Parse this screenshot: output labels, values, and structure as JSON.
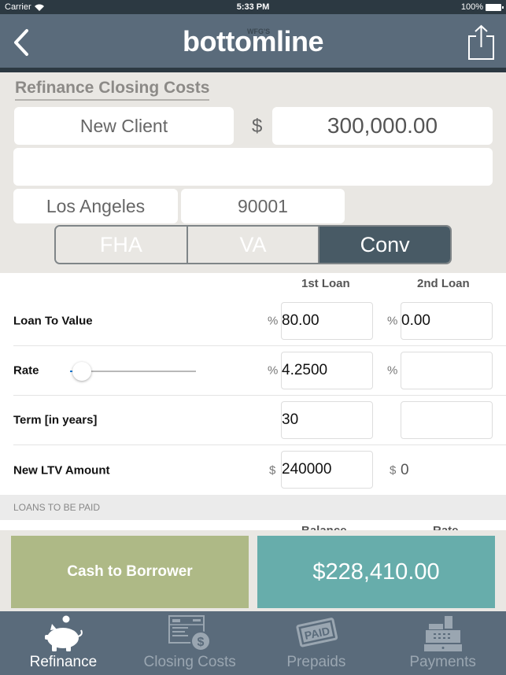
{
  "status_bar": {
    "carrier": "Carrier",
    "time": "5:33 PM",
    "battery": "100%"
  },
  "nav": {
    "logo_small": "WFG'S",
    "logo": "bottomline",
    "back_icon": "chevron-left-icon",
    "share_icon": "share-icon"
  },
  "form": {
    "section_title": "Refinance Closing Costs",
    "client_name": "New Client",
    "currency_symbol": "$",
    "amount": "300,000.00",
    "address": "",
    "city": "Los Angeles",
    "zip": "90001",
    "loan_types": [
      {
        "label": "FHA",
        "selected": false
      },
      {
        "label": "VA",
        "selected": false
      },
      {
        "label": "Conv",
        "selected": true
      }
    ]
  },
  "loans_table": {
    "col_headers": [
      "1st Loan",
      "2nd Loan"
    ],
    "rows": [
      {
        "label": "Loan To Value",
        "prefix1": "%",
        "value1": "80.00",
        "prefix2": "%",
        "value2": "0.00"
      },
      {
        "label": "Rate",
        "prefix1": "%",
        "value1": "4.2500",
        "prefix2": "%",
        "value2": ""
      },
      {
        "label": "Term [in years]",
        "prefix1": "",
        "value1": "30",
        "prefix2": "",
        "value2": ""
      },
      {
        "label": "New LTV Amount",
        "prefix1": "$",
        "value1": "240000",
        "prefix2": "$",
        "value2": "0"
      }
    ],
    "rate_slider_fraction": 0.02
  },
  "loans_to_be_paid": {
    "header": "LOANS TO BE PAID",
    "col_headers": [
      "Balance",
      "Rate"
    ]
  },
  "summary": {
    "label": "Cash to Borrower",
    "value": "$228,410.00",
    "label_color": "#aeb986",
    "value_color": "#67adab"
  },
  "tabs": [
    {
      "label": "Refinance",
      "icon": "piggy-bank-icon",
      "active": true
    },
    {
      "label": "Closing Costs",
      "icon": "document-dollar-icon",
      "active": false
    },
    {
      "label": "Prepaids",
      "icon": "paid-stamp-icon",
      "active": false
    },
    {
      "label": "Payments",
      "icon": "cash-register-icon",
      "active": false
    }
  ]
}
